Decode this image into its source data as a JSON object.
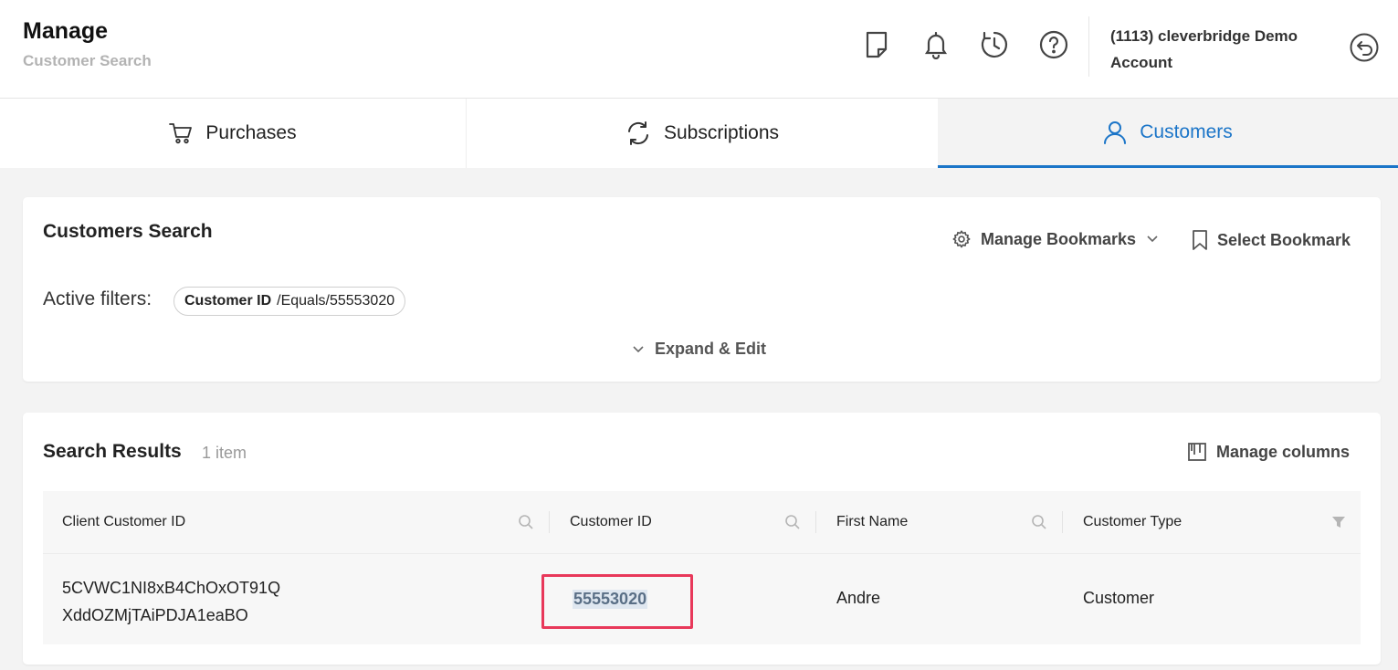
{
  "header": {
    "title": "Manage",
    "subtitle": "Customer Search",
    "icons": [
      "notes-icon",
      "bell-icon",
      "history-icon",
      "help-icon",
      "logout-icon"
    ],
    "account_name": "(1113) cleverbridge Demo Account"
  },
  "tabs": [
    {
      "label": "Purchases",
      "icon": "cart-icon",
      "active": false
    },
    {
      "label": "Subscriptions",
      "icon": "refresh-icon",
      "active": false
    },
    {
      "label": "Customers",
      "icon": "user-icon",
      "active": true
    }
  ],
  "search_card": {
    "title": "Customers Search",
    "manage_bookmarks_label": "Manage Bookmarks",
    "select_bookmark_label": "Select Bookmark",
    "active_filters_label": "Active filters:",
    "filter": {
      "field": "Customer ID",
      "condition": "/Equals/55553020"
    },
    "expand_label": "Expand & Edit"
  },
  "results": {
    "title": "Search Results",
    "count": "1 item",
    "manage_columns_label": "Manage columns",
    "columns": [
      "Client Customer ID",
      "Customer ID",
      "First Name",
      "Customer Type"
    ],
    "rows": [
      {
        "client_customer_id_line1": "5CVWC1NI8xB4ChOxOT91Q",
        "client_customer_id_line2": "XddOZMjTAiPDJA1eaBO",
        "customer_id": "55553020",
        "first_name": "Andre",
        "customer_type": "Customer"
      }
    ]
  },
  "colors": {
    "accent": "#1b75c8",
    "highlight_border": "#e8385a"
  }
}
